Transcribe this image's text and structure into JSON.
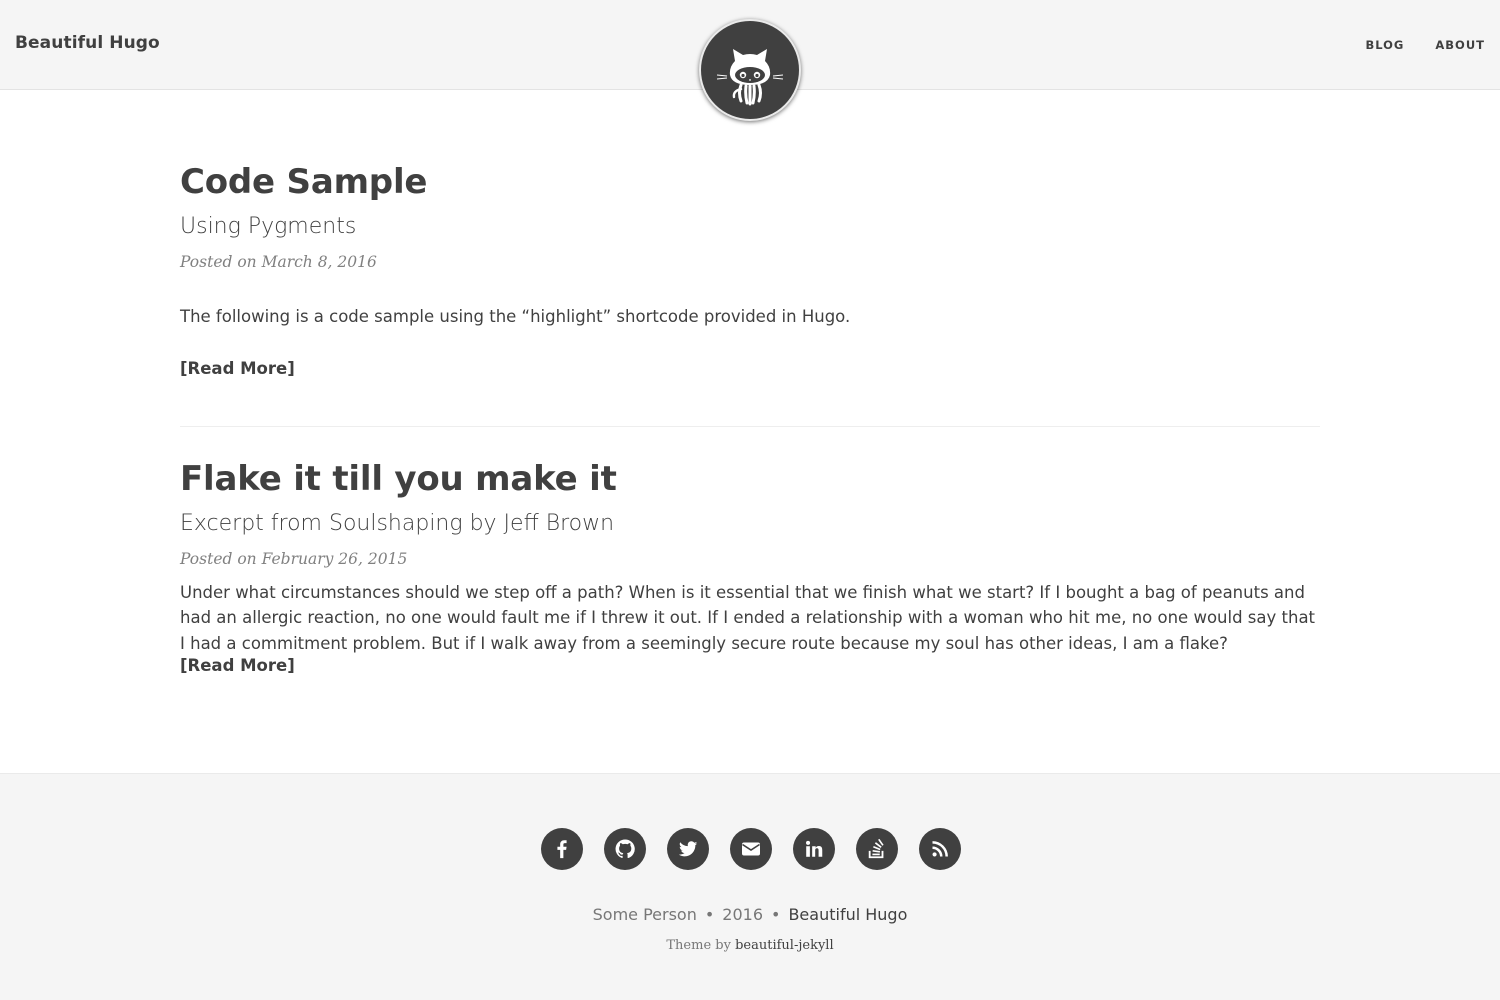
{
  "navbar": {
    "brand": "Beautiful Hugo",
    "links": [
      {
        "label": "BLOG"
      },
      {
        "label": "ABOUT"
      }
    ]
  },
  "posts": [
    {
      "title": "Code Sample",
      "subtitle": "Using Pygments",
      "meta": "Posted on March 8, 2016",
      "excerpt": "The following is a code sample using the “highlight” shortcode provided in Hugo.",
      "read_more": "[Read More]"
    },
    {
      "title": "Flake it till you make it",
      "subtitle": "Excerpt from Soulshaping by Jeff Brown",
      "meta": "Posted on February 26, 2015",
      "excerpt": "Under what circumstances should we step off a path? When is it essential that we finish what we start? If I bought a bag of peanuts and had an allergic reaction, no one would fault me if I threw it out. If I ended a relationship with a woman who hit me, no one would say that I had a commitment problem. But if I walk away from a seemingly secure route because my soul has other ideas, I am a flake?",
      "read_more": "[Read More]"
    }
  ],
  "footer": {
    "social_icons": [
      "facebook-icon",
      "github-icon",
      "twitter-icon",
      "email-icon",
      "linkedin-icon",
      "stackoverflow-icon",
      "rss-icon"
    ],
    "author": "Some Person",
    "separator": "•",
    "year": "2016",
    "site_name": "Beautiful Hugo",
    "theme_prefix": "Theme by",
    "theme_name": "beautiful-jekyll"
  },
  "colors": {
    "text": "#404040",
    "muted": "#808080",
    "nav_bg": "#f5f5f5",
    "footer_bg": "#f5f5f5",
    "icon_bg": "#404040"
  }
}
